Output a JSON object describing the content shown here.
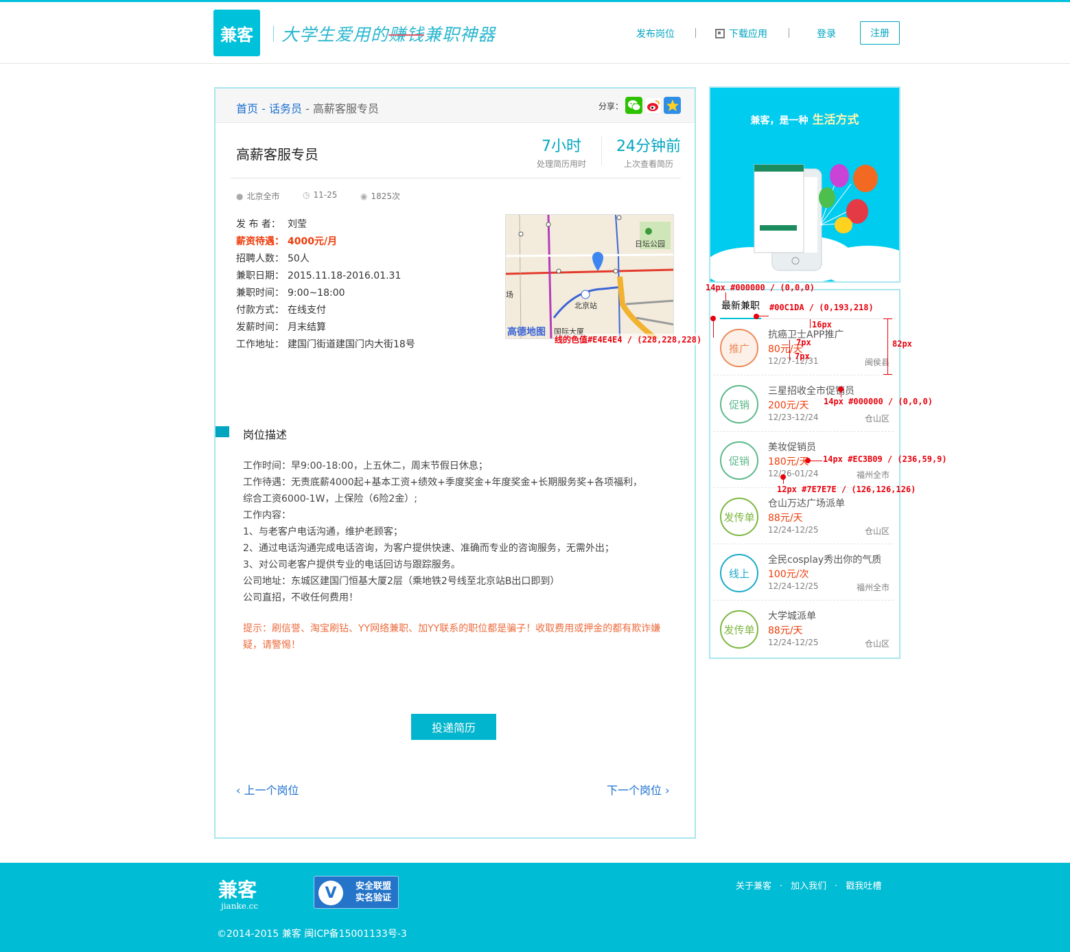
{
  "header": {
    "logo": "兼客",
    "slogan_a": "大学生爱用的",
    "slogan_b": "赚钱",
    "slogan_c": "兼职神器",
    "nav_post": "发布岗位",
    "nav_download": "下载应用",
    "nav_login": "登录",
    "nav_register": "注册"
  },
  "breadcrumb": {
    "home": "首页",
    "sep1": " - ",
    "category": "话务员",
    "sep2": " - ",
    "current": "高薪客服专员"
  },
  "share": {
    "label": "分享："
  },
  "job": {
    "title": "高薪客服专员",
    "stat1_value": "7小时",
    "stat1_label": "处理简历用时",
    "stat2_value": "24分钟前",
    "stat2_label": "上次查看简历",
    "location": "北京全市",
    "date": "11-25",
    "views": "1825次"
  },
  "info": [
    {
      "key": "发 布 者：",
      "value": "刘莹"
    },
    {
      "key": "薪资待遇：",
      "value": "4000元/月"
    },
    {
      "key": "招聘人数：",
      "value": "50人"
    },
    {
      "key": "兼职日期：",
      "value": "2015.11.18-2016.01.31"
    },
    {
      "key": "兼职时间：",
      "value": "9:00~18:00"
    },
    {
      "key": "付款方式：",
      "value": "在线支付"
    },
    {
      "key": "发薪时间：",
      "value": "月末结算"
    },
    {
      "key": "工作地址：",
      "value": "建国门街道建国门内大街18号"
    }
  ],
  "map": {
    "label_park": "日坛公园",
    "label_station": "北京站",
    "label_building": "国际大厦",
    "label_left": "场",
    "brand": "高德地图"
  },
  "description": {
    "title": "岗位描述",
    "lines": [
      "工作时间：早9:00-18:00，上五休二，周末节假日休息；",
      "工作待遇：无责底薪4000起+基本工资+绩效+季度奖金+年度奖金+长期服务奖+各项福利，",
      "综合工资6000-1W，上保险（6险2金）;",
      "工作内容：",
      "1、与老客户电话沟通，维护老顾客；",
      "2、通过电话沟通完成电话咨询，为客户提供快速、准确而专业的咨询服务，无需外出；",
      "3、对公司老客户提供专业的电话回访与跟踪服务。",
      "公司地址：东城区建国门恒基大厦2层（乘地铁2号线至北京站B出口即到）",
      "公司直招，不收任何费用！"
    ],
    "tip": "提示：刷信誉、淘宝刷钻、YY网络兼职、加YY联系的职位都是骗子！收取费用或押金的都有欺诈嫌疑，请警惕！"
  },
  "actions": {
    "apply": "投递简历",
    "prev": "上一个岗位",
    "next": "下一个岗位"
  },
  "banner": {
    "text": "兼客，是一种",
    "highlight": "生活方式"
  },
  "sidebar": {
    "title": "最新兼职",
    "jobs": [
      {
        "badge": "推广",
        "color": "#EC8A5A",
        "name": "抗癌卫士APP推广",
        "pay": "80元/天",
        "date": "12/27-12/31",
        "loc": "闽侯县"
      },
      {
        "badge": "促销",
        "color": "#5CB88A",
        "name": "三星招收全市促销员",
        "pay": "200元/天",
        "date": "12/23-12/24",
        "loc": "仓山区"
      },
      {
        "badge": "促销",
        "color": "#5CB88A",
        "name": "美妆促销员",
        "pay": "180元/天",
        "date": "12/26-01/24",
        "loc": "福州全市"
      },
      {
        "badge": "发传单",
        "color": "#7DB640",
        "name": "仓山万达广场派单",
        "pay": "88元/天",
        "date": "12/24-12/25",
        "loc": "仓山区"
      },
      {
        "badge": "线上",
        "color": "#1AA9C9",
        "name": "全民cosplay秀出你的气质",
        "pay": "100元/次",
        "date": "12/24-12/25",
        "loc": "福州全市"
      },
      {
        "badge": "发传单",
        "color": "#7DB640",
        "name": "大学城派单",
        "pay": "88元/天",
        "date": "12/24-12/25",
        "loc": "仓山区"
      }
    ]
  },
  "annotations": {
    "a1": "14px #000000 / (0,0,0)",
    "a2": "#00C1DA / (0,193,218)",
    "a3": "16px",
    "a4": "7px",
    "a5": "7px",
    "a6": "82px",
    "a7": "线的色值#E4E4E4 / (228,228,228)",
    "a8": "14px #000000 / (0,0,0)",
    "a9": "14px #EC3B09 / (236,59,9)",
    "a10": "12px #7E7E7E / (126,126,126)"
  },
  "footer": {
    "logo": "兼客",
    "domain": "jianke.cc",
    "badge_line1": "安全联盟",
    "badge_line2": "实名验证",
    "badge_icon": "V",
    "link_about": "关于兼客",
    "link_join": "加入我们",
    "link_feedback": "戳我吐槽",
    "dot": "·",
    "copyright": "©2014-2015 兼客 闽ICP备15001133号-3"
  }
}
